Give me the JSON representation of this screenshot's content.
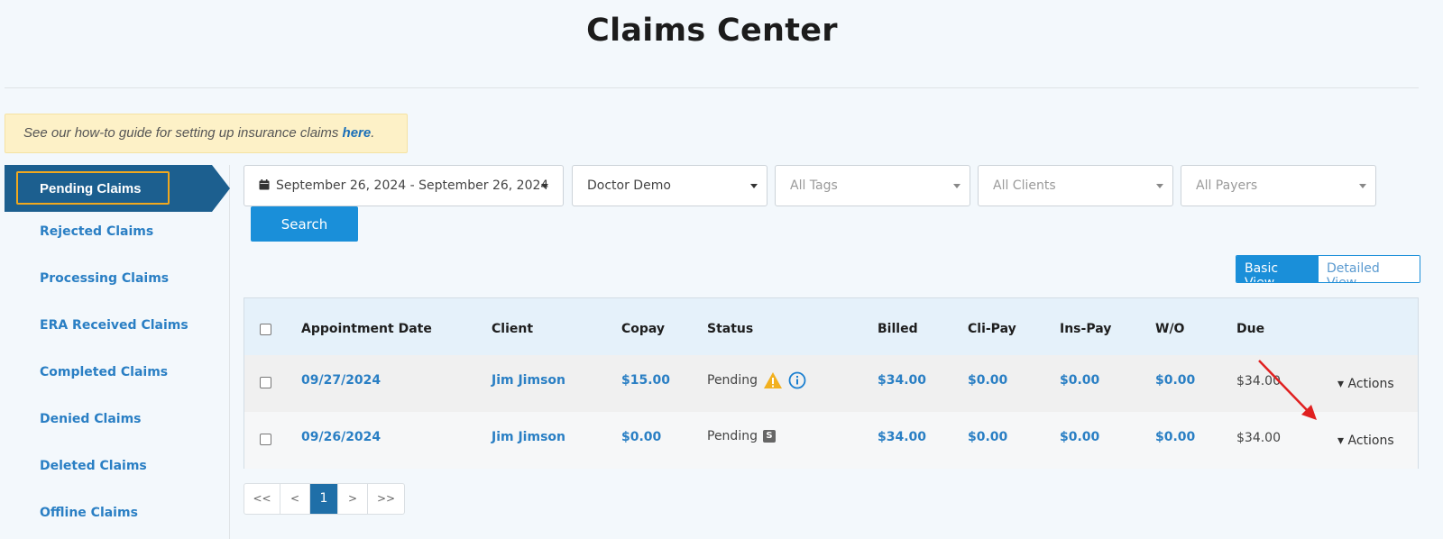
{
  "page": {
    "title": "Claims Center"
  },
  "guide": {
    "text": "See our how-to guide for setting up insurance claims ",
    "link": "here",
    "suffix": "."
  },
  "sidebar": {
    "active": "Pending Claims",
    "items": [
      {
        "label": "Rejected Claims"
      },
      {
        "label": "Processing Claims"
      },
      {
        "label": "ERA Received Claims"
      },
      {
        "label": "Completed Claims"
      },
      {
        "label": "Denied Claims"
      },
      {
        "label": "Deleted Claims"
      },
      {
        "label": "Offline Claims"
      }
    ]
  },
  "filters": {
    "date_range": "September 26, 2024 - September 26, 2024",
    "provider": "Doctor Demo",
    "tags": "All Tags",
    "clients": "All Clients",
    "payers": "All Payers",
    "search_label": "Search"
  },
  "view_toggle": {
    "basic": "Basic View",
    "detailed": "Detailed View",
    "active": "Basic View"
  },
  "table": {
    "headers": {
      "appointment_date": "Appointment Date",
      "client": "Client",
      "copay": "Copay",
      "status": "Status",
      "billed": "Billed",
      "cli_pay": "Cli-Pay",
      "ins_pay": "Ins-Pay",
      "wo": "W/O",
      "due": "Due"
    },
    "rows": [
      {
        "date": "09/27/2024",
        "client": "Jim Jimson",
        "copay": "$15.00",
        "status": "Pending",
        "billed": "$34.00",
        "cli_pay": "$0.00",
        "ins_pay": "$0.00",
        "wo": "$0.00",
        "due": "$34.00",
        "actions": "Actions"
      },
      {
        "date": "09/26/2024",
        "client": "Jim Jimson",
        "copay": "$0.00",
        "status": "Pending",
        "status_badge": "S",
        "billed": "$34.00",
        "cli_pay": "$0.00",
        "ins_pay": "$0.00",
        "wo": "$0.00",
        "due": "$34.00",
        "actions": "Actions"
      }
    ]
  },
  "pagination": {
    "first": "<<",
    "prev": "<",
    "current": "1",
    "next": ">",
    "last": ">>"
  },
  "colors": {
    "primary": "#1a8fd9",
    "sidebar_active": "#1c5f8f",
    "highlight": "#f0a81e",
    "link": "#2a7fc4",
    "warning": "#f2b01e",
    "annotation_arrow": "#e02020"
  }
}
